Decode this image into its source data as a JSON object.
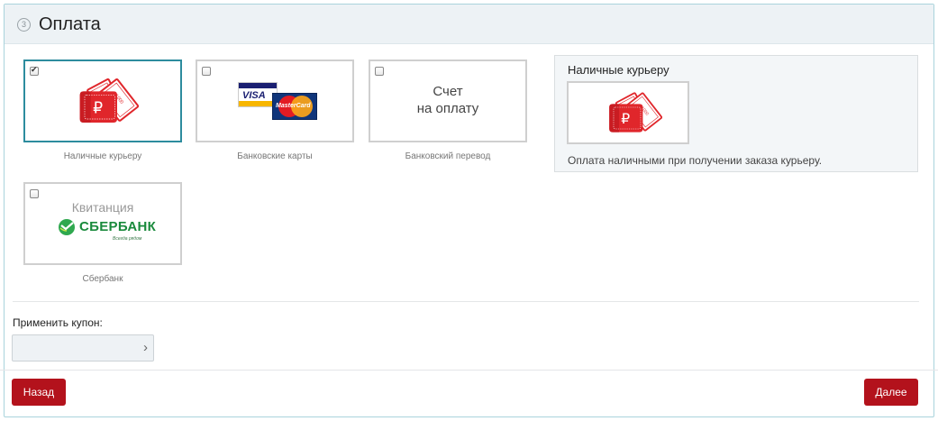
{
  "header": {
    "step_number": "3",
    "title": "Оплата"
  },
  "payment_options": [
    {
      "label": "Наличные курьеру",
      "checked": true
    },
    {
      "label": "Банковские карты",
      "checked": false,
      "visa_text": "VISA",
      "mastercard_text": "MasterCard"
    },
    {
      "label": "Банковский перевод",
      "checked": false,
      "image_text_line1": "Счет",
      "image_text_line2": "на оплату"
    },
    {
      "label": "Сбербанк",
      "checked": false,
      "image_title": "Квитанция",
      "bank_name": "СБЕРБАНК",
      "slogan": "Всегда рядом"
    }
  ],
  "details": {
    "title": "Наличные курьеру",
    "description": "Оплата наличными при получении заказа курьеру."
  },
  "coupon": {
    "label": "Применить купон:",
    "value": "",
    "placeholder": ""
  },
  "buttons": {
    "back": "Назад",
    "next": "Далее"
  },
  "colors": {
    "accent_red": "#b3121c",
    "selected_border": "#2d8c9e",
    "header_bg": "#edf2f5"
  }
}
